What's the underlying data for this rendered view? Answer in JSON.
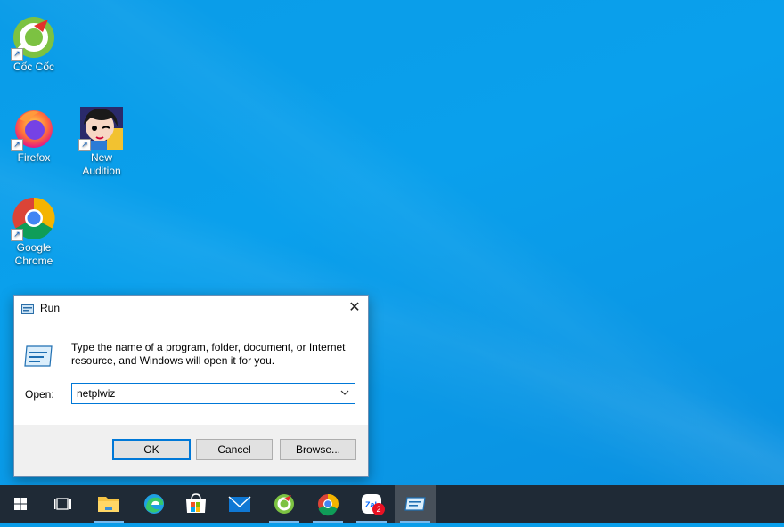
{
  "desktop": {
    "icons": [
      {
        "label": "Cốc Cốc"
      },
      {
        "label": "Firefox"
      },
      {
        "label": "New Audition"
      },
      {
        "label": "Google Chrome"
      }
    ]
  },
  "run_dialog": {
    "title": "Run",
    "description": "Type the name of a program, folder, document, or Internet resource, and Windows will open it for you.",
    "open_label": "Open:",
    "open_value": "netplwiz",
    "ok_label": "OK",
    "cancel_label": "Cancel",
    "browse_label": "Browse..."
  },
  "taskbar": {
    "items": [
      {
        "name": "start-button"
      },
      {
        "name": "task-view-button"
      },
      {
        "name": "file-explorer"
      },
      {
        "name": "edge"
      },
      {
        "name": "microsoft-store"
      },
      {
        "name": "mail"
      },
      {
        "name": "coc-coc"
      },
      {
        "name": "chrome"
      },
      {
        "name": "zalo",
        "badge": "2"
      },
      {
        "name": "run-app"
      }
    ]
  },
  "colors": {
    "accent": "#0078d7",
    "taskbar": "#1f2a36",
    "desktop": "#0a9ce8"
  }
}
